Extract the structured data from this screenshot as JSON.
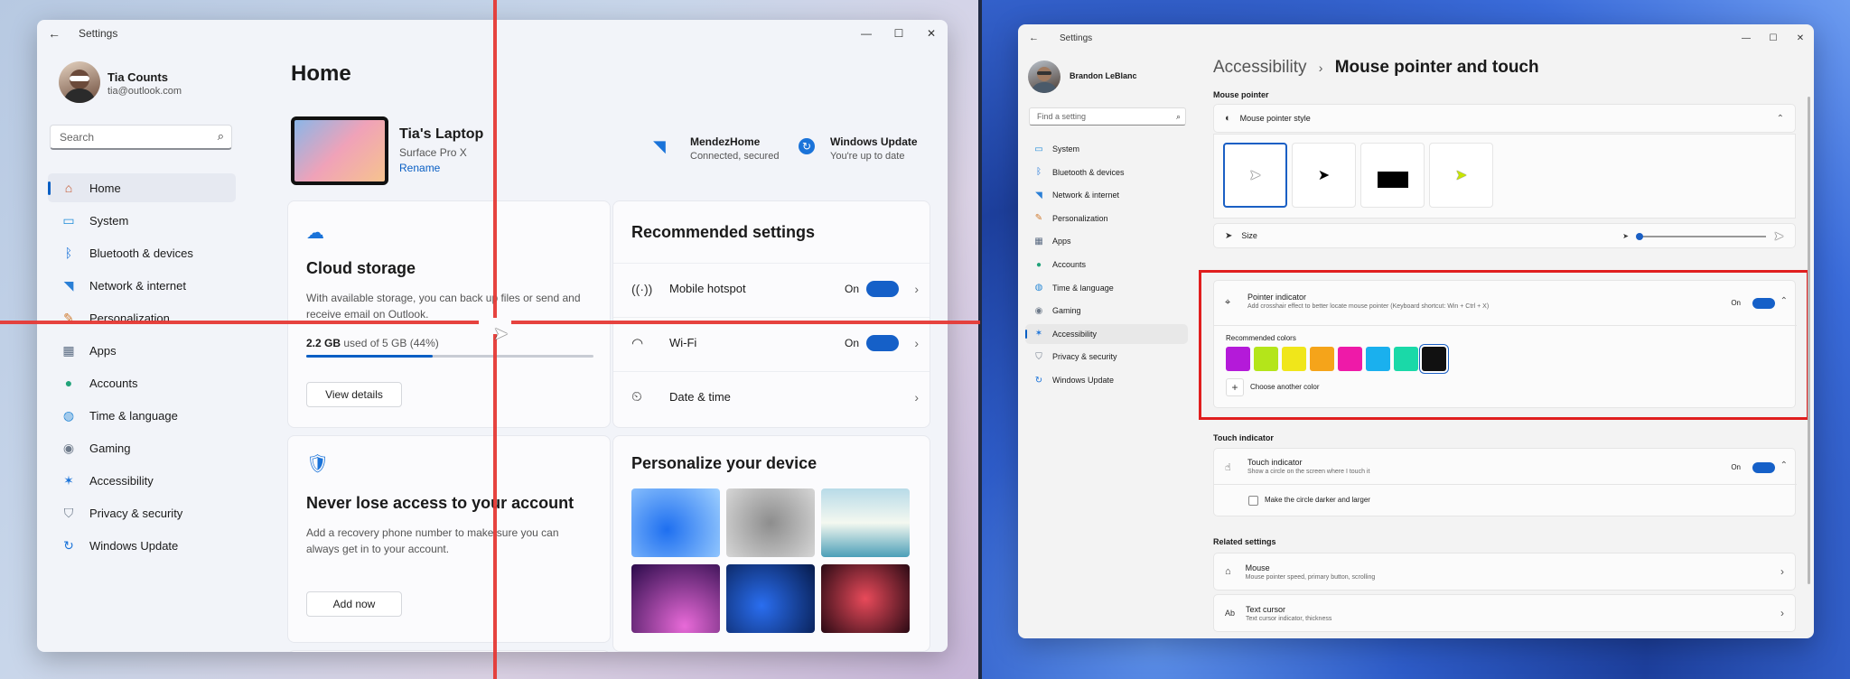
{
  "left_window": {
    "title": "Settings",
    "user": {
      "name": "Tia Counts",
      "email": "tia@outlook.com"
    },
    "search_placeholder": "Search",
    "nav": [
      {
        "label": "Home",
        "icon": "home-icon",
        "color": "#c4562e"
      },
      {
        "label": "System",
        "icon": "system-icon",
        "color": "#1e8bd8"
      },
      {
        "label": "Bluetooth & devices",
        "icon": "bluetooth-icon",
        "color": "#1a73d9"
      },
      {
        "label": "Network & internet",
        "icon": "wifi-icon",
        "color": "#2a7fd6"
      },
      {
        "label": "Personalization",
        "icon": "brush-icon",
        "color": "#d07a2e"
      },
      {
        "label": "Apps",
        "icon": "apps-icon",
        "color": "#5a6b82"
      },
      {
        "label": "Accounts",
        "icon": "accounts-icon",
        "color": "#22a37a"
      },
      {
        "label": "Time & language",
        "icon": "globe-icon",
        "color": "#2a89d6"
      },
      {
        "label": "Gaming",
        "icon": "gaming-icon",
        "color": "#6e7a8a"
      },
      {
        "label": "Accessibility",
        "icon": "accessibility-icon",
        "color": "#1a73d9"
      },
      {
        "label": "Privacy & security",
        "icon": "shield-icon",
        "color": "#6e7a8a"
      },
      {
        "label": "Windows Update",
        "icon": "update-icon",
        "color": "#1a73d9"
      }
    ],
    "page_title": "Home",
    "device": {
      "name": "Tia's Laptop",
      "model": "Surface Pro X",
      "rename": "Rename"
    },
    "status": [
      {
        "title": "MendezHome",
        "subtitle": "Connected, secured",
        "icon": "wifi-icon"
      },
      {
        "title": "Windows Update",
        "subtitle": "You're up to date",
        "icon": "update-icon"
      }
    ],
    "cloud": {
      "title": "Cloud storage",
      "desc": "With available storage, you can back up files or send and receive email on Outlook.",
      "used_strong": "2.2 GB",
      "used_rest": " used of 5 GB (44%)",
      "progress": 44,
      "button": "View details"
    },
    "account": {
      "title": "Never lose access to your account",
      "desc": "Add a recovery phone number to make sure you can always get in to your account.",
      "button": "Add now"
    },
    "recommended": {
      "title": "Recommended settings",
      "items": [
        {
          "label": "Mobile hotspot",
          "state": "On",
          "icon": "hotspot-icon"
        },
        {
          "label": "Wi-Fi",
          "state": "On",
          "icon": "wifi-icon"
        },
        {
          "label": "Date & time",
          "state": "",
          "icon": "clock-icon"
        }
      ]
    },
    "personalize": {
      "title": "Personalize your device"
    }
  },
  "right_window": {
    "title": "Settings",
    "user": {
      "name": "Brandon LeBlanc"
    },
    "search_placeholder": "Find a setting",
    "nav": [
      {
        "label": "System",
        "icon": "system-icon",
        "color": "#1e8bd8"
      },
      {
        "label": "Bluetooth & devices",
        "icon": "bluetooth-icon",
        "color": "#1a73d9"
      },
      {
        "label": "Network & internet",
        "icon": "wifi-icon",
        "color": "#2a7fd6"
      },
      {
        "label": "Personalization",
        "icon": "brush-icon",
        "color": "#d07a2e"
      },
      {
        "label": "Apps",
        "icon": "apps-icon",
        "color": "#5a6b82"
      },
      {
        "label": "Accounts",
        "icon": "accounts-icon",
        "color": "#22a37a"
      },
      {
        "label": "Time & language",
        "icon": "globe-icon",
        "color": "#2a89d6"
      },
      {
        "label": "Gaming",
        "icon": "gaming-icon",
        "color": "#6e7a8a"
      },
      {
        "label": "Accessibility",
        "icon": "accessibility-icon",
        "color": "#1a73d9"
      },
      {
        "label": "Privacy & security",
        "icon": "shield-icon",
        "color": "#6e7a8a"
      },
      {
        "label": "Windows Update",
        "icon": "update-icon",
        "color": "#1a73d9"
      }
    ],
    "breadcrumb": {
      "parent": "Accessibility",
      "sep": "›",
      "current": "Mouse pointer and touch"
    },
    "section_mouse": "Mouse pointer",
    "pointer_style": "Mouse pointer style",
    "size": "Size",
    "size_level": 0,
    "pointer_indicator": {
      "title": "Pointer indicator",
      "desc": "Add crosshair effect to better locate mouse pointer (Keyboard shortcut: Win + Ctrl + X)",
      "state": "On",
      "recommended_label": "Recommended colors",
      "colors": [
        "#b41ad9",
        "#b4e51a",
        "#f0e61a",
        "#f5a41a",
        "#ee1aa8",
        "#1ab0ee",
        "#1ad9a8",
        "#111111"
      ],
      "choose_label": "Choose another color"
    },
    "section_touch": "Touch indicator",
    "touch_indicator": {
      "title": "Touch indicator",
      "desc": "Show a circle on the screen where I touch it",
      "state": "On",
      "checkbox_label": "Make the circle darker and larger"
    },
    "section_related": "Related settings",
    "related": [
      {
        "title": "Mouse",
        "desc": "Mouse pointer speed, primary button, scrolling",
        "icon": "mouse-icon"
      },
      {
        "title": "Text cursor",
        "desc": "Text cursor indicator, thickness",
        "icon": "text-cursor-icon"
      }
    ]
  }
}
